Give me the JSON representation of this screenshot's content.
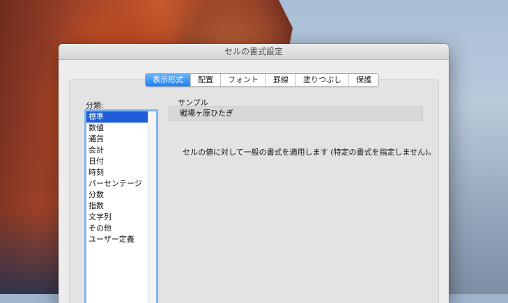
{
  "window": {
    "title": "セルの書式設定"
  },
  "tabs": [
    {
      "label": "表示形式",
      "active": true
    },
    {
      "label": "配置",
      "active": false
    },
    {
      "label": "フォント",
      "active": false
    },
    {
      "label": "罫線",
      "active": false
    },
    {
      "label": "塗りつぶし",
      "active": false
    },
    {
      "label": "保護",
      "active": false
    }
  ],
  "category": {
    "label": "分類:",
    "selected": "標準",
    "items": [
      "標準",
      "数値",
      "通貨",
      "会計",
      "日付",
      "時刻",
      "パーセンテージ",
      "分数",
      "指数",
      "文字列",
      "その他",
      "ユーザー定義"
    ]
  },
  "sample": {
    "label": "サンプル",
    "value": "戦場ヶ原ひたぎ"
  },
  "description": "セルの値に対して一般の書式を適用します (特定の書式を指定しません)。",
  "colors": {
    "accent": "#1a82fb",
    "selection": "#1d5ed8",
    "list_border": "#7fb4ee"
  }
}
